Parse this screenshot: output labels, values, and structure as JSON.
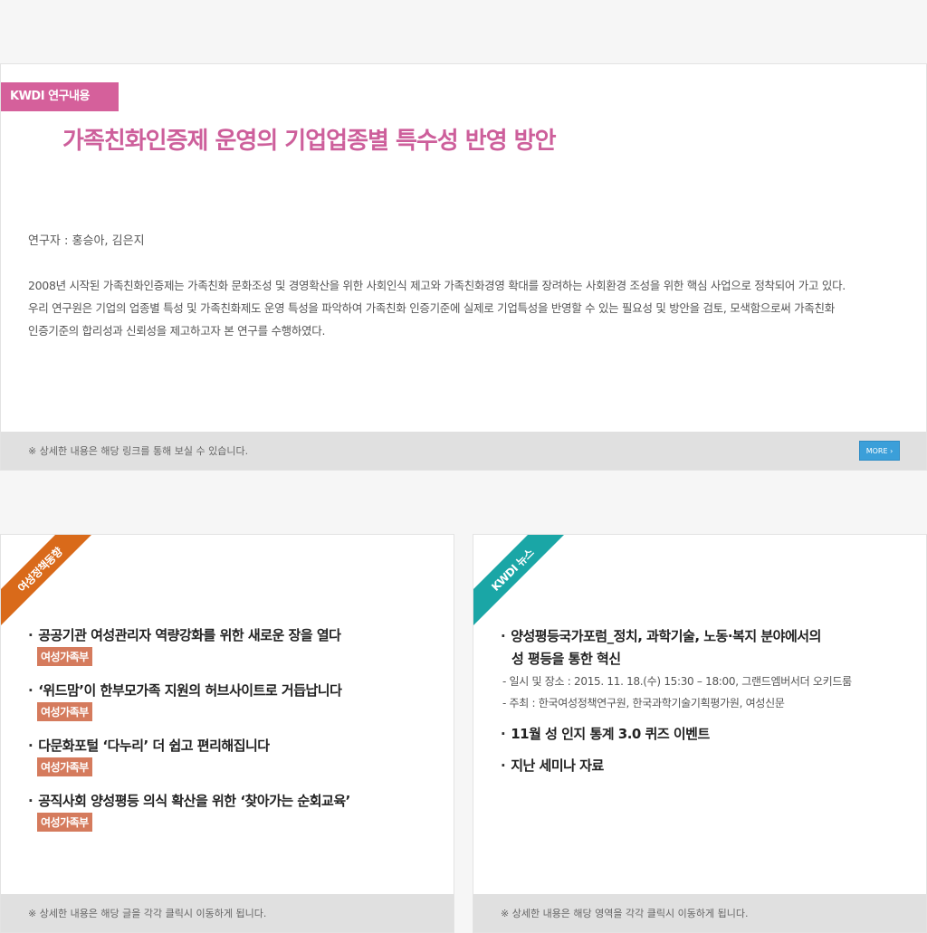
{
  "main": {
    "tag": "KWDI 연구내용",
    "title": "가족친화인증제 운영의 기업업종별 특수성 반영 방안",
    "researcher": "연구자 : 홍승아, 김은지",
    "desc_lines": [
      "2008년 시작된 가족친화인증제는 가족친화 문화조성 및 경영확산을 위한 사회인식 제고와 가족친화경영 확대를 장려하는 사회환경 조성을 위한 핵심 사업으로 정착되어 가고 있다.",
      "우리 연구원은 기업의 업종별 특성 및 가족친화제도 운영 특성을 파악하여 가족친화 인증기준에 실제로 기업특성을 반영할 수 있는 필요성 및 방안을 검토, 모색함으로써 가족친화",
      "인증기준의 합리성과 신뢰성을 제고하고자 본 연구를 수행하였다."
    ],
    "footnote": "※ 상세한 내용은 해당 링크를 통해 보실 수 있습니다.",
    "more_label": "MORE ›"
  },
  "policy": {
    "corner_label": "여성정책동향",
    "corner_color": "#d96a1a",
    "items": [
      {
        "title": "공공기관 여성관리자 역량강화를 위한 새로운 장을 열다",
        "badge": "여성가족부"
      },
      {
        "title": "‘위드맘’이 한부모가족 지원의 허브사이트로 거듭납니다",
        "badge": "여성가족부"
      },
      {
        "title": "다문화포털 ‘다누리’ 더 쉽고 편리해집니다",
        "badge": "여성가족부"
      },
      {
        "title": "공직사회 양성평등 의식 확산을 위한 ‘찾아가는 순회교육’",
        "badge": "여성가족부"
      }
    ],
    "footnote": "※ 상세한 내용은 해당 글을 각각 클릭시 이동하게 됩니다."
  },
  "news": {
    "corner_label": "KWDI 뉴스",
    "corner_color": "#1aa6a6",
    "item1_title_line1": "양성평등국가포럼_정치, 과학기술, 노동·복지 분야에서의",
    "item1_title_line2": "성 평등을 통한 혁신",
    "item1_sub1": "-  일시 및 장소 :  2015. 11. 18.(수) 15:30 – 18:00, 그랜드엠버서더 오키드룸",
    "item1_sub2": "-  주최  :  한국여성정책연구원, 한국과학기술기획평가원, 여성신문",
    "item2_title": "11월 성 인지 통계 3.0 퀴즈 이벤트",
    "item3_title": "지난 세미나 자료",
    "footnote": "※ 상세한 내용은 해당 영역을 각각 클릭시 이동하게 됩니다."
  },
  "bullet": "·"
}
